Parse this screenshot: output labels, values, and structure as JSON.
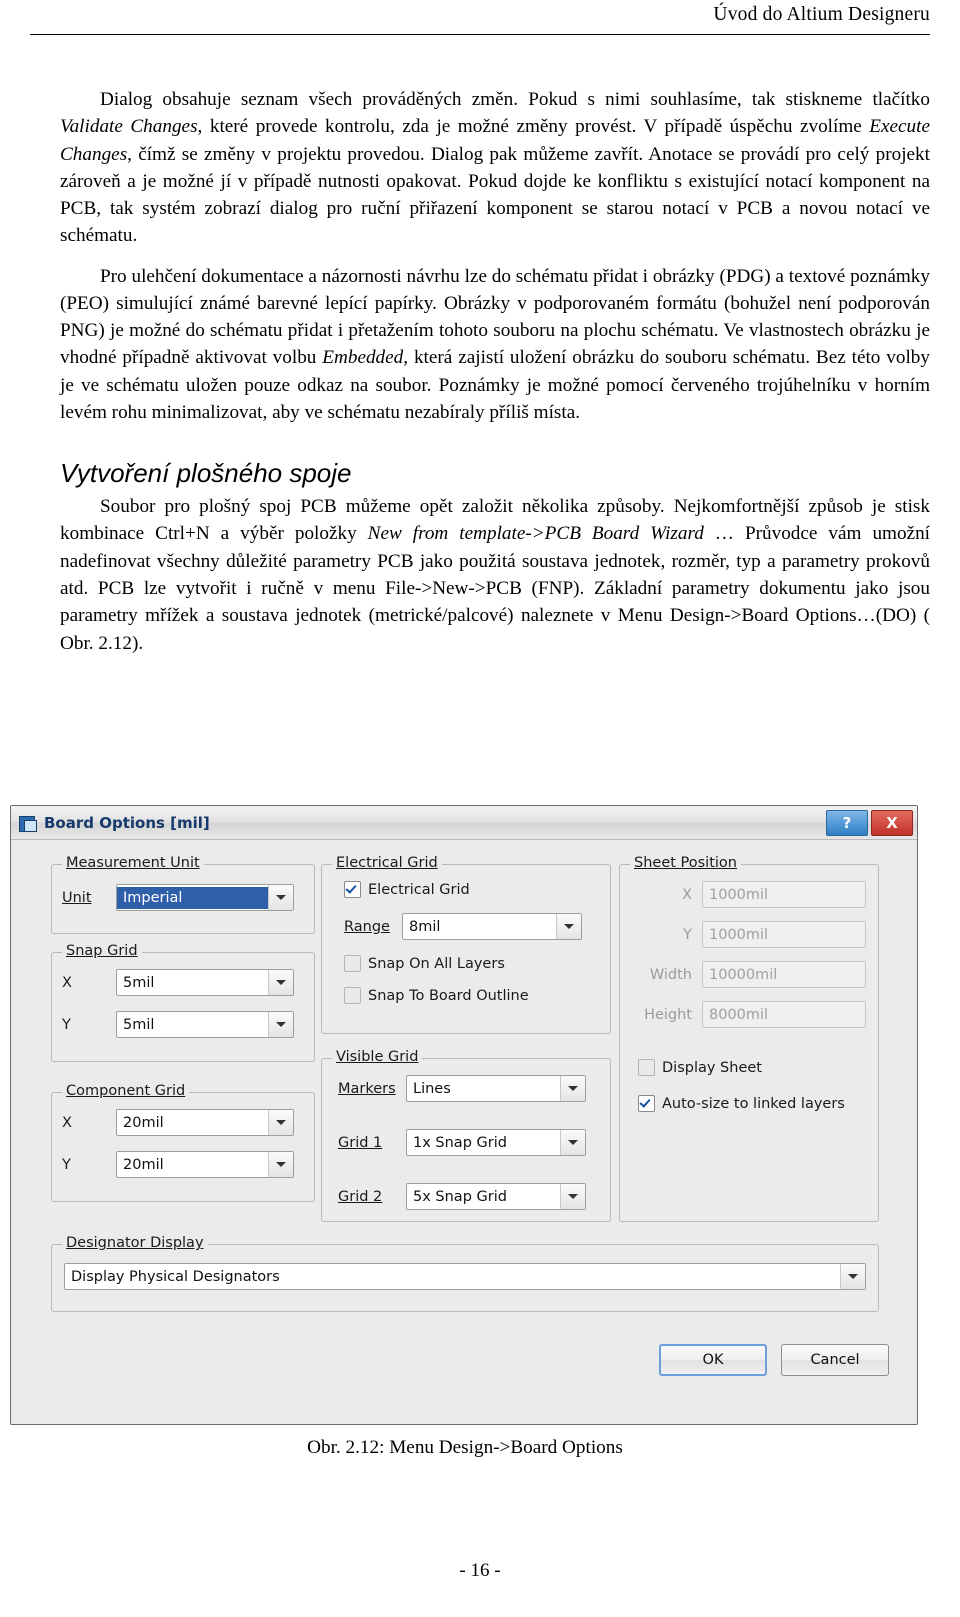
{
  "header": {
    "title": "Úvod do Altium Designeru"
  },
  "footer": {
    "page": "- 16 -"
  },
  "paragraphs": {
    "p1_a": "Dialog obsahuje seznam všech prováděných změn. Pokud s nimi souhlasíme, tak stiskneme tlačítko ",
    "p1_i1": "Validate Changes",
    "p1_b": ", které provede kontrolu, zda je možné změny provést. V případě úspěchu zvolíme ",
    "p1_i2": "Execute Changes",
    "p1_c": ", čímž se změny v projektu provedou. Dialog pak můžeme zavřít. Anotace se provádí pro celý projekt zároveň a je možné jí v případě nutnosti opakovat. Pokud dojde ke konfliktu s existující notací komponent na PCB, tak systém zobrazí dialog pro ruční přiřazení komponent se starou notací v PCB a novou notací ve schématu.",
    "p2_a": "Pro ulehčení dokumentace a názornosti návrhu lze do schématu přidat i obrázky (PDG) a textové poznámky (PEO) simulující známé barevné lepící papírky. Obrázky v podporovaném formátu (bohužel není podporován PNG) je možné do schématu přidat i přetažením tohoto souboru na plochu schématu. Ve vlastnostech obrázku je vhodné případně aktivovat volbu ",
    "p2_i1": "Embedded",
    "p2_b": ", která zajistí uložení obrázku do souboru schématu. Bez této volby je ve schématu uložen pouze odkaz na soubor. Poznámky je možné pomocí červeného trojúhelníku v horním levém rohu minimalizovat, aby ve schématu nezabíraly příliš místa.",
    "section_title": "Vytvoření plošného spoje",
    "p3_a": "Soubor pro plošný spoj PCB můžeme opět založit několika způsoby. Nejkomfortnější způsob je stisk kombinace Ctrl+N a výběr položky ",
    "p3_i1": "New from template->PCB Board Wizard",
    "p3_b": " … Průvodce vám umožní nadefinovat všechny důležité parametry PCB jako použitá soustava jednotek, rozměr, typ a parametry prokovů atd. PCB lze vytvořit i ručně v menu  File->New->PCB  (FNP). Základní parametry dokumentu jako jsou parametry mřížek a  soustava jednotek (metrické/palcové)  naleznete v  Menu Design->Board Options…(DO) ( Obr. 2.12)."
  },
  "figure": {
    "caption": "Obr. 2.12: Menu Design->Board Options"
  },
  "dialog": {
    "title": "Board Options [mil]",
    "titlebar_buttons": {
      "help": "?",
      "close": "X"
    },
    "groups": {
      "measurement_unit": {
        "title": "Measurement Unit",
        "unit_label": "Unit",
        "unit_value": "Imperial"
      },
      "snap_grid": {
        "title": "Snap Grid",
        "x_label": "X",
        "x_value": "5mil",
        "y_label": "Y",
        "y_value": "5mil"
      },
      "component_grid": {
        "title": "Component Grid",
        "x_label": "X",
        "x_value": "20mil",
        "y_label": "Y",
        "y_value": "20mil"
      },
      "electrical_grid": {
        "title": "Electrical Grid",
        "enable_label": "Electrical Grid",
        "enable_checked": true,
        "range_label": "Range",
        "range_value": "8mil",
        "snap_all_layers_label": "Snap On All Layers",
        "snap_all_layers_checked": false,
        "snap_board_outline_label": "Snap To Board Outline",
        "snap_board_outline_checked": false
      },
      "visible_grid": {
        "title": "Visible Grid",
        "markers_label": "Markers",
        "markers_value": "Lines",
        "grid1_label": "Grid 1",
        "grid1_value": "1x Snap Grid",
        "grid2_label": "Grid 2",
        "grid2_value": "5x Snap Grid"
      },
      "sheet_position": {
        "title": "Sheet Position",
        "x_label": "X",
        "x_value": "1000mil",
        "y_label": "Y",
        "y_value": "1000mil",
        "width_label": "Width",
        "width_value": "10000mil",
        "height_label": "Height",
        "height_value": "8000mil",
        "display_sheet_label": "Display Sheet",
        "display_sheet_checked": false,
        "autosize_label": "Auto-size to linked layers",
        "autosize_checked": true
      },
      "designator_display": {
        "title": "Designator Display",
        "value": "Display Physical Designators"
      }
    },
    "buttons": {
      "ok": "OK",
      "cancel": "Cancel"
    }
  }
}
